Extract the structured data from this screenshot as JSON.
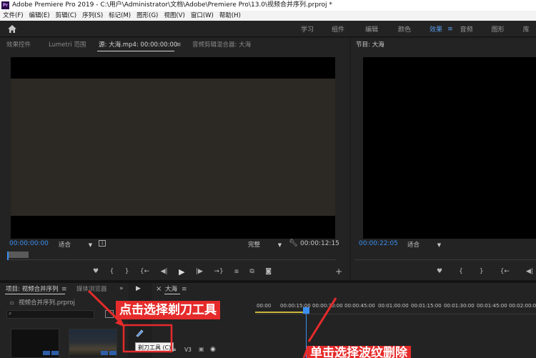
{
  "window": {
    "logo_text": "Pr",
    "title": "Adobe Premiere Pro 2019 - C:\\用户\\Administrator\\文档\\Adobe\\Premiere Pro\\13.0\\视频合并序列.prproj *"
  },
  "menu": [
    "文件(F)",
    "编辑(E)",
    "剪辑(C)",
    "序列(S)",
    "标记(M)",
    "图形(G)",
    "视图(V)",
    "窗口(W)",
    "帮助(H)"
  ],
  "workspaces": {
    "tabs": [
      "学习",
      "组件",
      "编辑",
      "颜色",
      "效果",
      "音频",
      "图形",
      "库"
    ],
    "active": "效果"
  },
  "source_panel": {
    "tabs": [
      "效果控件",
      "Lumetri 范围",
      "源: 大海.mp4: 00:00:00:00",
      "音频剪辑混合器: 大海"
    ],
    "active_tab": "源: 大海.mp4: 00:00:00:00",
    "timecode_in": "00:00:00:00",
    "zoom": "适合",
    "quality": "完整",
    "timecode_duration": "00:00:12:15"
  },
  "program_panel": {
    "title": "节目: 大海",
    "timecode": "00:00:22:05",
    "zoom": "适合"
  },
  "project_panel": {
    "tabs": [
      "项目: 视频合并序列",
      "媒体浏览器"
    ],
    "file": "视频合并序列.prproj"
  },
  "timeline": {
    "sequence_name": "大海",
    "ruler": [
      "00:00",
      "00:00:15:00",
      "00:00:30:00",
      "00:00:45:00",
      "00:01:00:00",
      "00:01:15:00",
      "00:01:30:00",
      "00:01:45:00",
      "00:02:00:00"
    ],
    "track": "V3"
  },
  "tooltip": "剃刀工具 (C)",
  "annotations": {
    "top": "点击选择剃刀工具",
    "bottom": "单击选择波纹删除"
  },
  "colors": {
    "accent": "#3a8ff0",
    "annotation": "#e52b2b",
    "active_tab": "#5a9ce8"
  }
}
